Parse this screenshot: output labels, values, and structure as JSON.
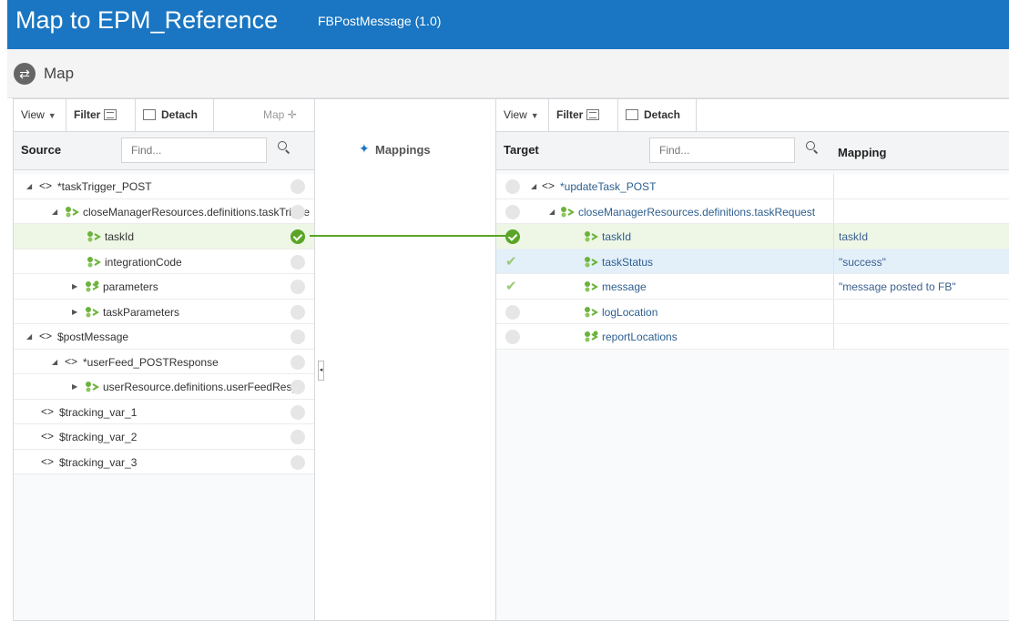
{
  "header": {
    "title": "Map to EPM_Reference",
    "subtitle": "FBPostMessage (1.0)"
  },
  "mapbar": {
    "label": "Map"
  },
  "source": {
    "toolbar": {
      "view": "View",
      "filter": "Filter",
      "detach": "Detach",
      "map": "Map"
    },
    "header_label": "Source",
    "find_placeholder": "Find...",
    "rows": [
      {
        "label": "*taskTrigger_POST"
      },
      {
        "label": "closeManagerResources.definitions.taskTrigge"
      },
      {
        "label": "taskId"
      },
      {
        "label": "integrationCode"
      },
      {
        "label": "parameters"
      },
      {
        "label": "taskParameters"
      },
      {
        "label": "$postMessage"
      },
      {
        "label": "*userFeed_POSTResponse"
      },
      {
        "label": "userResource.definitions.userFeedRespo"
      },
      {
        "label": "$tracking_var_1"
      },
      {
        "label": "$tracking_var_2"
      },
      {
        "label": "$tracking_var_3"
      }
    ]
  },
  "mappings": {
    "label": "Mappings"
  },
  "target": {
    "toolbar": {
      "view": "View",
      "filter": "Filter",
      "detach": "Detach"
    },
    "header_label": "Target",
    "find_placeholder": "Find...",
    "mapping_header": "Mapping",
    "rows": [
      {
        "label": "*updateTask_POST",
        "mapping": ""
      },
      {
        "label": "closeManagerResources.definitions.taskRequest",
        "mapping": ""
      },
      {
        "label": "taskId",
        "mapping": "taskId"
      },
      {
        "label": "taskStatus",
        "mapping": "\"success\""
      },
      {
        "label": "message",
        "mapping": "\"message posted to FB\""
      },
      {
        "label": "logLocation",
        "mapping": ""
      },
      {
        "label": "reportLocations",
        "mapping": ""
      }
    ]
  },
  "colors": {
    "header": "#1a76c2",
    "mapped": "#5aa527",
    "leaf_icon": "#6bb33a"
  }
}
